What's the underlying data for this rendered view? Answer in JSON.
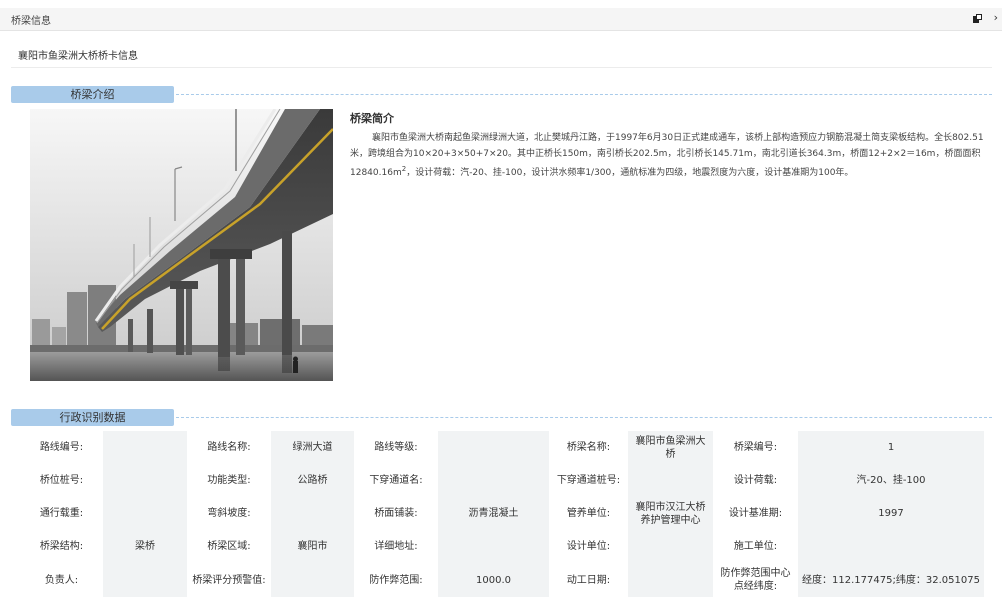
{
  "window": {
    "title": "桥梁信息"
  },
  "page": {
    "subtitle": "襄阳市鱼梁洲大桥桥卡信息"
  },
  "sections": {
    "intro": "桥梁介绍",
    "admin": "行政识别数据"
  },
  "intro": {
    "title": "桥梁简介",
    "text_before": "襄阳市鱼梁洲大桥南起鱼梁洲绿洲大道，北止樊城丹江路，于1997年6月30日正式建成通车，该桥上部构造预应力钢筋混凝土简支梁板结构。全长802.51米，跨境组合为10×20+3×50+7×20。其中正桥长150m，南引桥长202.5m，北引桥长145.71m，南北引道长364.3m，桥面12+2×2＝16m，桥面面积12840.16m",
    "superscript": "2",
    "text_after": "，设计荷载：汽-20、挂-100，设计洪水频率1/300，通航标准为四级，地震烈度为六度，设计基准期为100年。"
  },
  "table": {
    "rows": [
      [
        {
          "t": "label",
          "v": "路线编号:"
        },
        {
          "t": "value",
          "v": ""
        },
        {
          "t": "label",
          "v": "路线名称:"
        },
        {
          "t": "value",
          "v": "绿洲大道"
        },
        {
          "t": "label",
          "v": "路线等级:"
        },
        {
          "t": "value",
          "v": ""
        },
        {
          "t": "label",
          "v": "桥梁名称:"
        },
        {
          "t": "value",
          "v": "襄阳市鱼梁洲大桥"
        },
        {
          "t": "label",
          "v": "桥梁编号:"
        },
        {
          "t": "value",
          "v": "1"
        }
      ],
      [
        {
          "t": "label",
          "v": "桥位桩号:"
        },
        {
          "t": "value",
          "v": ""
        },
        {
          "t": "label",
          "v": "功能类型:"
        },
        {
          "t": "value",
          "v": "公路桥"
        },
        {
          "t": "label",
          "v": "下穿通道名:"
        },
        {
          "t": "value",
          "v": ""
        },
        {
          "t": "label",
          "v": "下穿通道桩号:"
        },
        {
          "t": "value",
          "v": ""
        },
        {
          "t": "label",
          "v": "设计荷载:"
        },
        {
          "t": "value",
          "v": "汽-20、挂-100"
        }
      ],
      [
        {
          "t": "label",
          "v": "通行载重:"
        },
        {
          "t": "value",
          "v": ""
        },
        {
          "t": "label",
          "v": "弯斜坡度:"
        },
        {
          "t": "value",
          "v": ""
        },
        {
          "t": "label",
          "v": "桥面铺装:"
        },
        {
          "t": "value",
          "v": "沥青混凝土"
        },
        {
          "t": "label",
          "v": "管养单位:"
        },
        {
          "t": "value",
          "v": "襄阳市汉江大桥养护管理中心"
        },
        {
          "t": "label",
          "v": "设计基准期:"
        },
        {
          "t": "value",
          "v": "1997"
        }
      ],
      [
        {
          "t": "label",
          "v": "桥梁结构:"
        },
        {
          "t": "value",
          "v": "梁桥"
        },
        {
          "t": "label",
          "v": "桥梁区域:"
        },
        {
          "t": "value",
          "v": "襄阳市"
        },
        {
          "t": "label",
          "v": "详细地址:"
        },
        {
          "t": "value",
          "v": ""
        },
        {
          "t": "label",
          "v": "设计单位:"
        },
        {
          "t": "value",
          "v": ""
        },
        {
          "t": "label",
          "v": "施工单位:"
        },
        {
          "t": "value",
          "v": ""
        }
      ],
      [
        {
          "t": "label",
          "v": "负责人:"
        },
        {
          "t": "value",
          "v": ""
        },
        {
          "t": "label",
          "v": "桥梁评分预警值:"
        },
        {
          "t": "value",
          "v": ""
        },
        {
          "t": "label",
          "v": "防作弊范围:"
        },
        {
          "t": "value",
          "v": "1000.0"
        },
        {
          "t": "label",
          "v": "动工日期:"
        },
        {
          "t": "value",
          "v": ""
        },
        {
          "t": "label",
          "v": "防作弊范围中心点经纬度:"
        },
        {
          "t": "value",
          "v": "经度：112.177475;纬度：32.051075"
        }
      ]
    ]
  }
}
